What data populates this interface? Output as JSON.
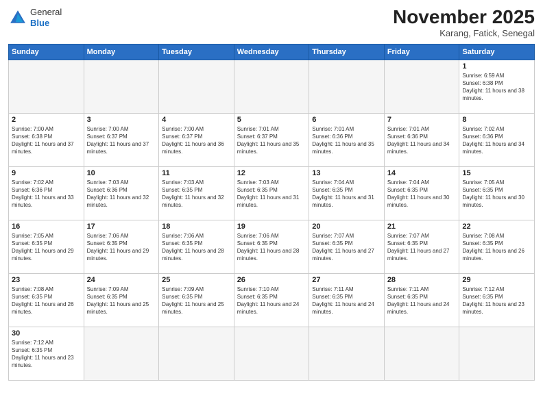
{
  "header": {
    "logo_general": "General",
    "logo_blue": "Blue",
    "month_year": "November 2025",
    "location": "Karang, Fatick, Senegal"
  },
  "weekdays": [
    "Sunday",
    "Monday",
    "Tuesday",
    "Wednesday",
    "Thursday",
    "Friday",
    "Saturday"
  ],
  "days": [
    {
      "num": "",
      "empty": true
    },
    {
      "num": "",
      "empty": true
    },
    {
      "num": "",
      "empty": true
    },
    {
      "num": "",
      "empty": true
    },
    {
      "num": "",
      "empty": true
    },
    {
      "num": "",
      "empty": true
    },
    {
      "num": "1",
      "sunrise": "6:59 AM",
      "sunset": "6:38 PM",
      "daylight": "11 hours and 38 minutes."
    },
    {
      "num": "2",
      "sunrise": "7:00 AM",
      "sunset": "6:38 PM",
      "daylight": "11 hours and 37 minutes."
    },
    {
      "num": "3",
      "sunrise": "7:00 AM",
      "sunset": "6:37 PM",
      "daylight": "11 hours and 37 minutes."
    },
    {
      "num": "4",
      "sunrise": "7:00 AM",
      "sunset": "6:37 PM",
      "daylight": "11 hours and 36 minutes."
    },
    {
      "num": "5",
      "sunrise": "7:01 AM",
      "sunset": "6:37 PM",
      "daylight": "11 hours and 35 minutes."
    },
    {
      "num": "6",
      "sunrise": "7:01 AM",
      "sunset": "6:36 PM",
      "daylight": "11 hours and 35 minutes."
    },
    {
      "num": "7",
      "sunrise": "7:01 AM",
      "sunset": "6:36 PM",
      "daylight": "11 hours and 34 minutes."
    },
    {
      "num": "8",
      "sunrise": "7:02 AM",
      "sunset": "6:36 PM",
      "daylight": "11 hours and 34 minutes."
    },
    {
      "num": "9",
      "sunrise": "7:02 AM",
      "sunset": "6:36 PM",
      "daylight": "11 hours and 33 minutes."
    },
    {
      "num": "10",
      "sunrise": "7:03 AM",
      "sunset": "6:36 PM",
      "daylight": "11 hours and 32 minutes."
    },
    {
      "num": "11",
      "sunrise": "7:03 AM",
      "sunset": "6:35 PM",
      "daylight": "11 hours and 32 minutes."
    },
    {
      "num": "12",
      "sunrise": "7:03 AM",
      "sunset": "6:35 PM",
      "daylight": "11 hours and 31 minutes."
    },
    {
      "num": "13",
      "sunrise": "7:04 AM",
      "sunset": "6:35 PM",
      "daylight": "11 hours and 31 minutes."
    },
    {
      "num": "14",
      "sunrise": "7:04 AM",
      "sunset": "6:35 PM",
      "daylight": "11 hours and 30 minutes."
    },
    {
      "num": "15",
      "sunrise": "7:05 AM",
      "sunset": "6:35 PM",
      "daylight": "11 hours and 30 minutes."
    },
    {
      "num": "16",
      "sunrise": "7:05 AM",
      "sunset": "6:35 PM",
      "daylight": "11 hours and 29 minutes."
    },
    {
      "num": "17",
      "sunrise": "7:06 AM",
      "sunset": "6:35 PM",
      "daylight": "11 hours and 29 minutes."
    },
    {
      "num": "18",
      "sunrise": "7:06 AM",
      "sunset": "6:35 PM",
      "daylight": "11 hours and 28 minutes."
    },
    {
      "num": "19",
      "sunrise": "7:06 AM",
      "sunset": "6:35 PM",
      "daylight": "11 hours and 28 minutes."
    },
    {
      "num": "20",
      "sunrise": "7:07 AM",
      "sunset": "6:35 PM",
      "daylight": "11 hours and 27 minutes."
    },
    {
      "num": "21",
      "sunrise": "7:07 AM",
      "sunset": "6:35 PM",
      "daylight": "11 hours and 27 minutes."
    },
    {
      "num": "22",
      "sunrise": "7:08 AM",
      "sunset": "6:35 PM",
      "daylight": "11 hours and 26 minutes."
    },
    {
      "num": "23",
      "sunrise": "7:08 AM",
      "sunset": "6:35 PM",
      "daylight": "11 hours and 26 minutes."
    },
    {
      "num": "24",
      "sunrise": "7:09 AM",
      "sunset": "6:35 PM",
      "daylight": "11 hours and 25 minutes."
    },
    {
      "num": "25",
      "sunrise": "7:09 AM",
      "sunset": "6:35 PM",
      "daylight": "11 hours and 25 minutes."
    },
    {
      "num": "26",
      "sunrise": "7:10 AM",
      "sunset": "6:35 PM",
      "daylight": "11 hours and 24 minutes."
    },
    {
      "num": "27",
      "sunrise": "7:11 AM",
      "sunset": "6:35 PM",
      "daylight": "11 hours and 24 minutes."
    },
    {
      "num": "28",
      "sunrise": "7:11 AM",
      "sunset": "6:35 PM",
      "daylight": "11 hours and 24 minutes."
    },
    {
      "num": "29",
      "sunrise": "7:12 AM",
      "sunset": "6:35 PM",
      "daylight": "11 hours and 23 minutes."
    },
    {
      "num": "30",
      "sunrise": "7:12 AM",
      "sunset": "6:35 PM",
      "daylight": "11 hours and 23 minutes."
    },
    {
      "num": "",
      "empty": true
    },
    {
      "num": "",
      "empty": true
    },
    {
      "num": "",
      "empty": true
    },
    {
      "num": "",
      "empty": true
    },
    {
      "num": "",
      "empty": true
    }
  ],
  "labels": {
    "sunrise": "Sunrise:",
    "sunset": "Sunset:",
    "daylight": "Daylight:"
  }
}
